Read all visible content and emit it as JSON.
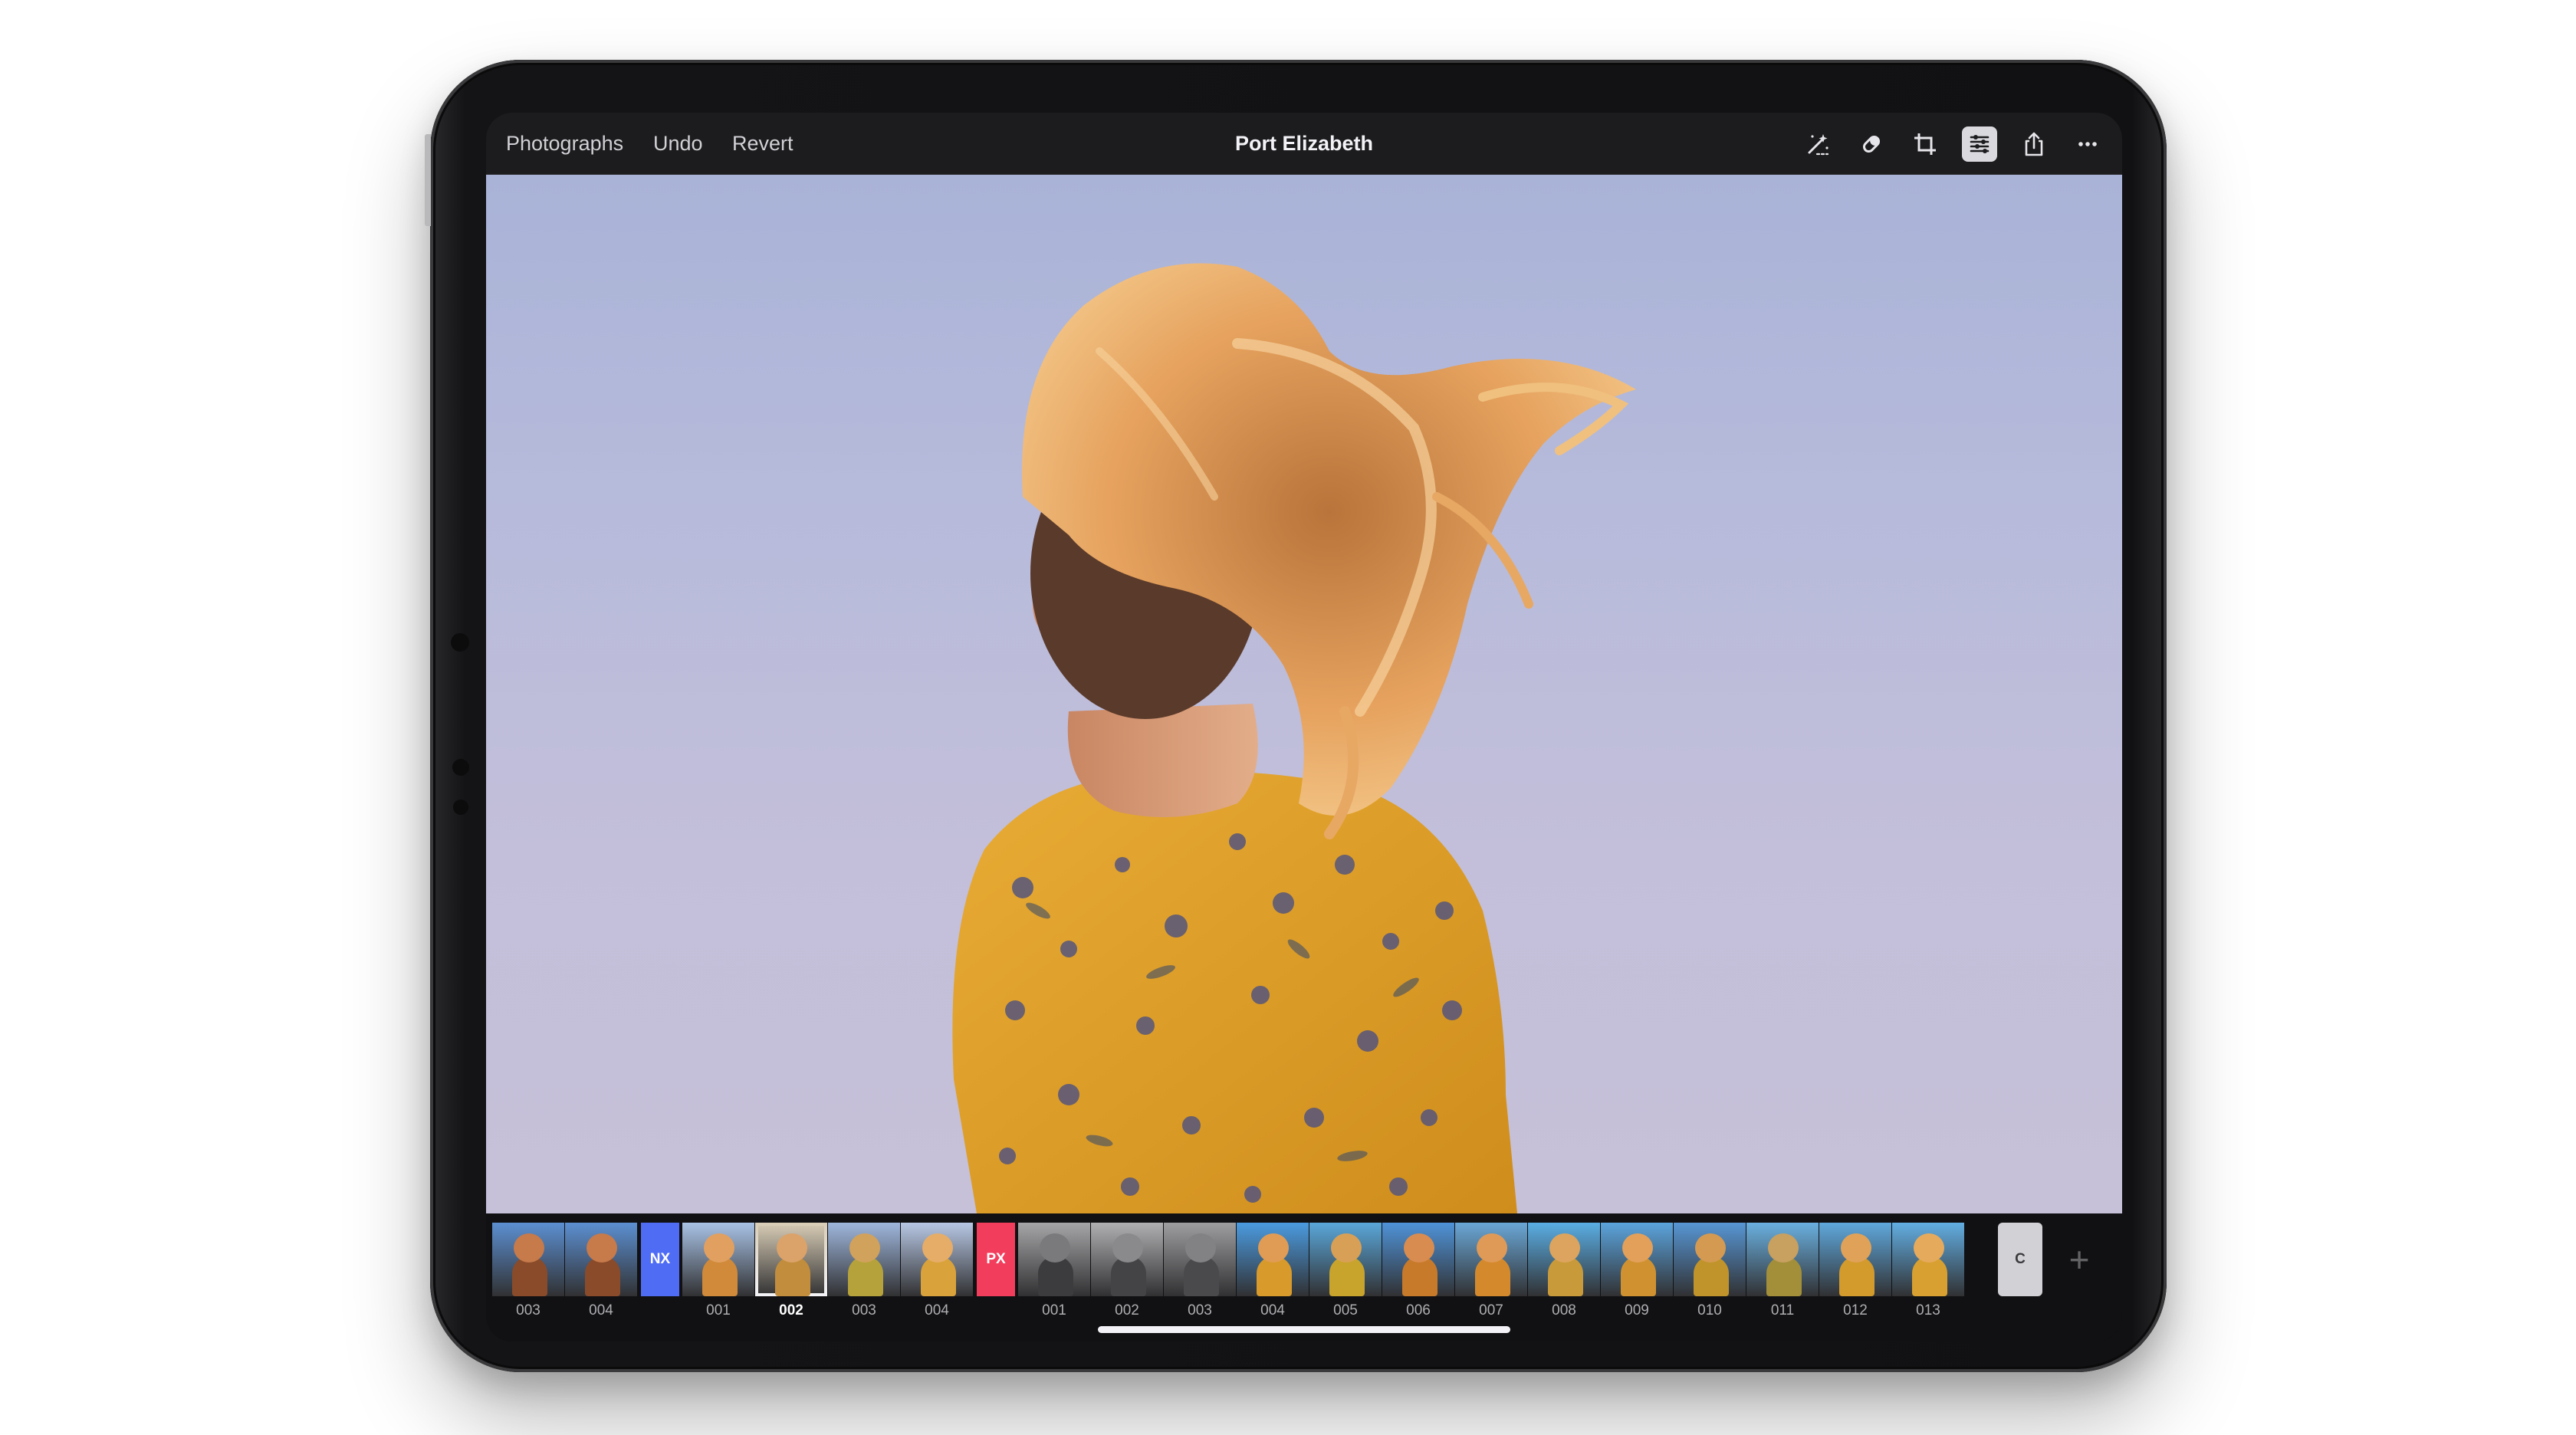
{
  "nav": {
    "back_label": "Photographs",
    "undo_label": "Undo",
    "revert_label": "Revert",
    "title": "Port Elizabeth"
  },
  "toolbar": {
    "icons": [
      "magic-wand-icon",
      "retouch-brush-icon",
      "crop-icon",
      "adjustments-icon",
      "share-icon",
      "more-icon"
    ],
    "active": "adjustments-icon"
  },
  "filmstrip": {
    "groups": [
      {
        "tag": "",
        "tag_color": "",
        "labels": [
          "003",
          "004"
        ]
      },
      {
        "tag": "NX",
        "tag_color": "#4f6cf5",
        "labels": [
          "001",
          "002",
          "003",
          "004"
        ]
      },
      {
        "tag": "PX",
        "tag_color": "#f23e5c",
        "labels": [
          "001",
          "002",
          "003",
          "004",
          "005",
          "006",
          "007",
          "008",
          "009",
          "010",
          "011",
          "012",
          "013"
        ]
      }
    ],
    "selected": "NX 002",
    "custom_tag": "C",
    "add_icon": "plus-icon"
  },
  "colors": {
    "screen_bg": "#1c1c1e",
    "sky": "#b6badb",
    "dress": "#e3a42c",
    "hair": "#e6a25e",
    "nx_tag": "#4f6cf5",
    "px_tag": "#f23e5c"
  }
}
